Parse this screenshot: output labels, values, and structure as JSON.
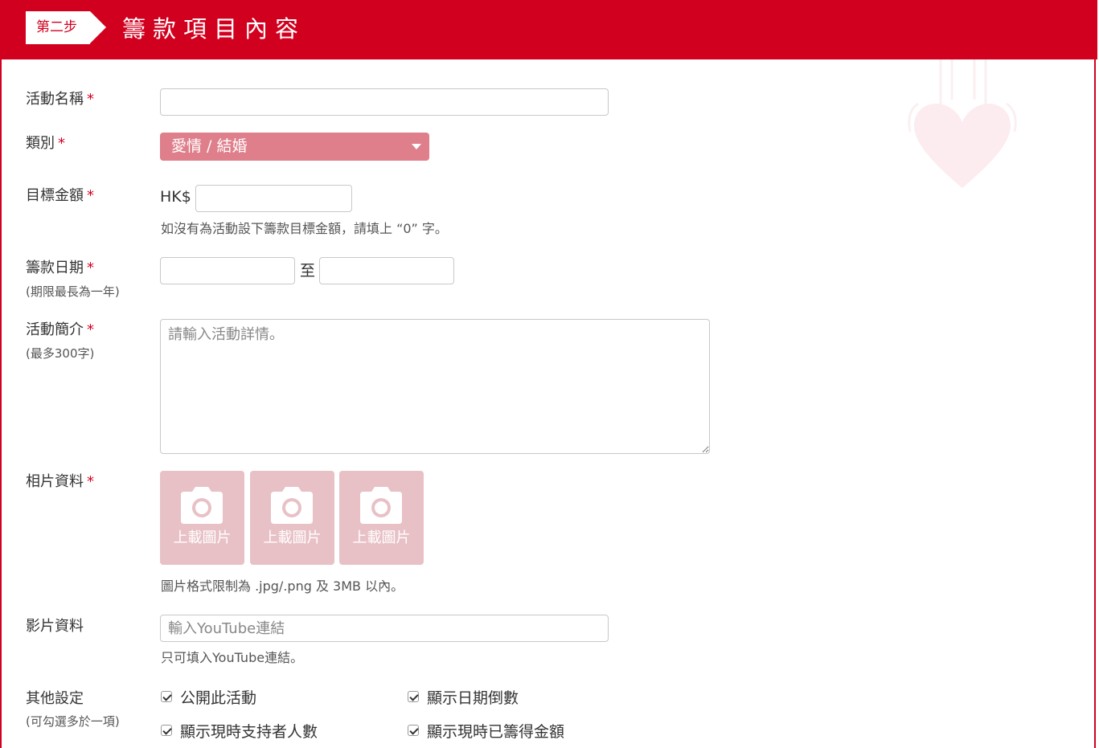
{
  "header": {
    "step": "第二步",
    "title": "籌款項目內容"
  },
  "form": {
    "name": {
      "label": "活動名稱",
      "required": "*",
      "value": ""
    },
    "category": {
      "label": "類別",
      "required": "*",
      "selected": "愛情 / 結婚"
    },
    "target": {
      "label": "目標金額",
      "required": "*",
      "currency": "HK$",
      "value": "",
      "hint": "如沒有為活動設下籌款目標金額，請填上 “0” 字。"
    },
    "dates": {
      "label": "籌款日期",
      "required": "*",
      "sublabel": "(期限最長為一年)",
      "separator": "至",
      "start": "",
      "end": ""
    },
    "intro": {
      "label": "活動簡介",
      "required": "*",
      "sublabel": "(最多300字)",
      "placeholder": "請輸入活動詳情。"
    },
    "photos": {
      "label": "相片資料",
      "required": "*",
      "slots": [
        {
          "label": "上載圖片",
          "icon": "camera-icon"
        },
        {
          "label": "上載圖片",
          "icon": "camera-icon"
        },
        {
          "label": "上載圖片",
          "icon": "camera-icon"
        }
      ],
      "hint": "圖片格式限制為 .jpg/.png 及 3MB 以內。"
    },
    "video": {
      "label": "影片資料",
      "placeholder": "輸入YouTube連結",
      "hint": "只可填入YouTube連結。"
    },
    "other": {
      "label": "其他設定",
      "sublabel": "(可勾選多於一項)",
      "options": [
        {
          "label": "公開此活動",
          "checked": true
        },
        {
          "label": "顯示日期倒數",
          "checked": true
        },
        {
          "label": "顯示現時支持者人數",
          "checked": true
        },
        {
          "label": "顯示現時已籌得金額",
          "checked": true
        }
      ]
    }
  },
  "colors": {
    "brand": "#d2001f",
    "select_bg": "#df7f8b",
    "photo_bg": "#e8c1c6"
  }
}
